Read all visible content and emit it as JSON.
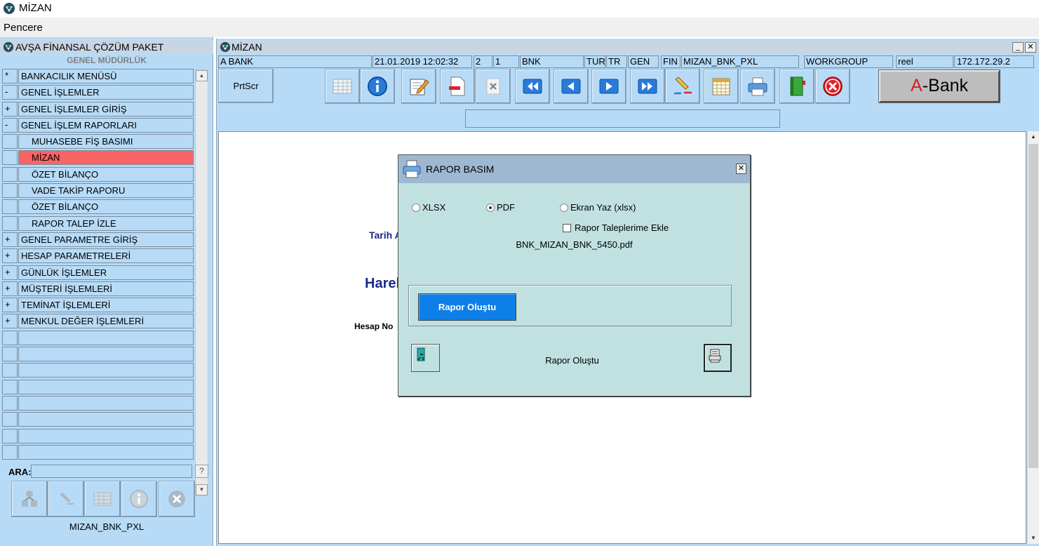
{
  "app": {
    "title": "MİZAN"
  },
  "menu": {
    "items": [
      "Pencere"
    ]
  },
  "left_panel": {
    "title": "AVŞA FİNANSAL ÇÖZÜM PAKET",
    "subtitle": "GENEL MÜDÜRLÜK",
    "tree": [
      {
        "mark": "*",
        "label": "BANKACILIK MENÜSÜ",
        "level": 1,
        "selected": false
      },
      {
        "mark": "-",
        "label": "GENEL İŞLEMLER",
        "level": 1,
        "selected": false
      },
      {
        "mark": "+",
        "label": "GENEL İŞLEMLER GİRİŞ",
        "level": 1,
        "selected": false
      },
      {
        "mark": "-",
        "label": "GENEL İŞLEM RAPORLARI",
        "level": 1,
        "selected": false
      },
      {
        "mark": "",
        "label": "MUHASEBE FİŞ BASIMI",
        "level": 2,
        "selected": false
      },
      {
        "mark": "",
        "label": "MİZAN",
        "level": 2,
        "selected": true
      },
      {
        "mark": "",
        "label": "ÖZET BİLANÇO",
        "level": 2,
        "selected": false
      },
      {
        "mark": "",
        "label": "VADE TAKİP RAPORU",
        "level": 2,
        "selected": false
      },
      {
        "mark": "",
        "label": "ÖZET BİLANÇO",
        "level": 2,
        "selected": false
      },
      {
        "mark": "",
        "label": "RAPOR TALEP İZLE",
        "level": 2,
        "selected": false
      },
      {
        "mark": "+",
        "label": "GENEL PARAMETRE GİRİŞ",
        "level": 1,
        "selected": false
      },
      {
        "mark": "+",
        "label": "HESAP PARAMETRELERİ",
        "level": 1,
        "selected": false
      },
      {
        "mark": "+",
        "label": "GÜNLÜK İŞLEMLER",
        "level": 1,
        "selected": false
      },
      {
        "mark": "+",
        "label": "MÜŞTERİ İŞLEMLERİ",
        "level": 1,
        "selected": false
      },
      {
        "mark": "+",
        "label": "TEMİNAT İŞLEMLERİ",
        "level": 1,
        "selected": false
      },
      {
        "mark": "+",
        "label": "MENKUL DEĞER İŞLEMLERİ",
        "level": 1,
        "selected": false
      },
      {
        "mark": "",
        "label": "",
        "level": 1,
        "selected": false
      },
      {
        "mark": "",
        "label": "",
        "level": 1,
        "selected": false
      },
      {
        "mark": "",
        "label": "",
        "level": 1,
        "selected": false
      },
      {
        "mark": "",
        "label": "",
        "level": 1,
        "selected": false
      },
      {
        "mark": "",
        "label": "",
        "level": 1,
        "selected": false
      },
      {
        "mark": "",
        "label": "",
        "level": 1,
        "selected": false
      },
      {
        "mark": "",
        "label": "",
        "level": 1,
        "selected": false
      },
      {
        "mark": "",
        "label": "",
        "level": 1,
        "selected": false
      }
    ],
    "search_label": "ARA:",
    "search_value": "",
    "help_label": "?",
    "footer": "MIZAN_BNK_PXL",
    "buttons": [
      "org-chart-icon",
      "pen-icon",
      "table-icon",
      "info-icon",
      "close-circle-icon"
    ]
  },
  "right_window": {
    "title": "MİZAN",
    "minimize": "_",
    "close": "✕",
    "info_fields": [
      "A BANK",
      "21.01.2019 12:02:32",
      "2",
      "1",
      "BNK",
      "TUR",
      "TR",
      "GEN",
      "FIN",
      "MIZAN_BNK_PXL",
      "WORKGROUP",
      "reel",
      "172.172.29.2"
    ],
    "prtscr_label": "PrtScr",
    "toolbar": [
      "table-icon",
      "info-icon",
      "edit-icon",
      "delete-record-icon",
      "clear-icon",
      "first-icon",
      "prev-icon",
      "next-icon",
      "last-icon",
      "highlight-icon",
      "calendar-icon",
      "print-icon",
      "book-icon",
      "exit-icon"
    ],
    "brand_button": {
      "prefix": "A",
      "suffix": "-Bank"
    },
    "status_field": "",
    "content": {
      "tarih_label": "Tarih A",
      "heading": "Harel",
      "hesap_label": "Hesap No"
    }
  },
  "dialog": {
    "title": "RAPOR BASIM",
    "close": "✕",
    "options": [
      {
        "label": "XLSX",
        "selected": false
      },
      {
        "label": "PDF",
        "selected": true
      },
      {
        "label": "Ekran Yaz (xlsx)",
        "selected": false
      }
    ],
    "checkbox_label": "Rapor Taleplerime Ekle",
    "checkbox_checked": false,
    "filename": "BNK_MIZAN_BNK_5450.pdf",
    "create_button": "Rapor Oluştu",
    "status": "Rapor Oluştu"
  },
  "colors": {
    "panel_bg": "#b7dbf7",
    "selected_row": "#f86464",
    "dialog_bg": "#c1e1e1",
    "dialog_title": "#9fb8d2",
    "primary_button": "#0e7fe8",
    "content_text": "#1a2a8a"
  }
}
